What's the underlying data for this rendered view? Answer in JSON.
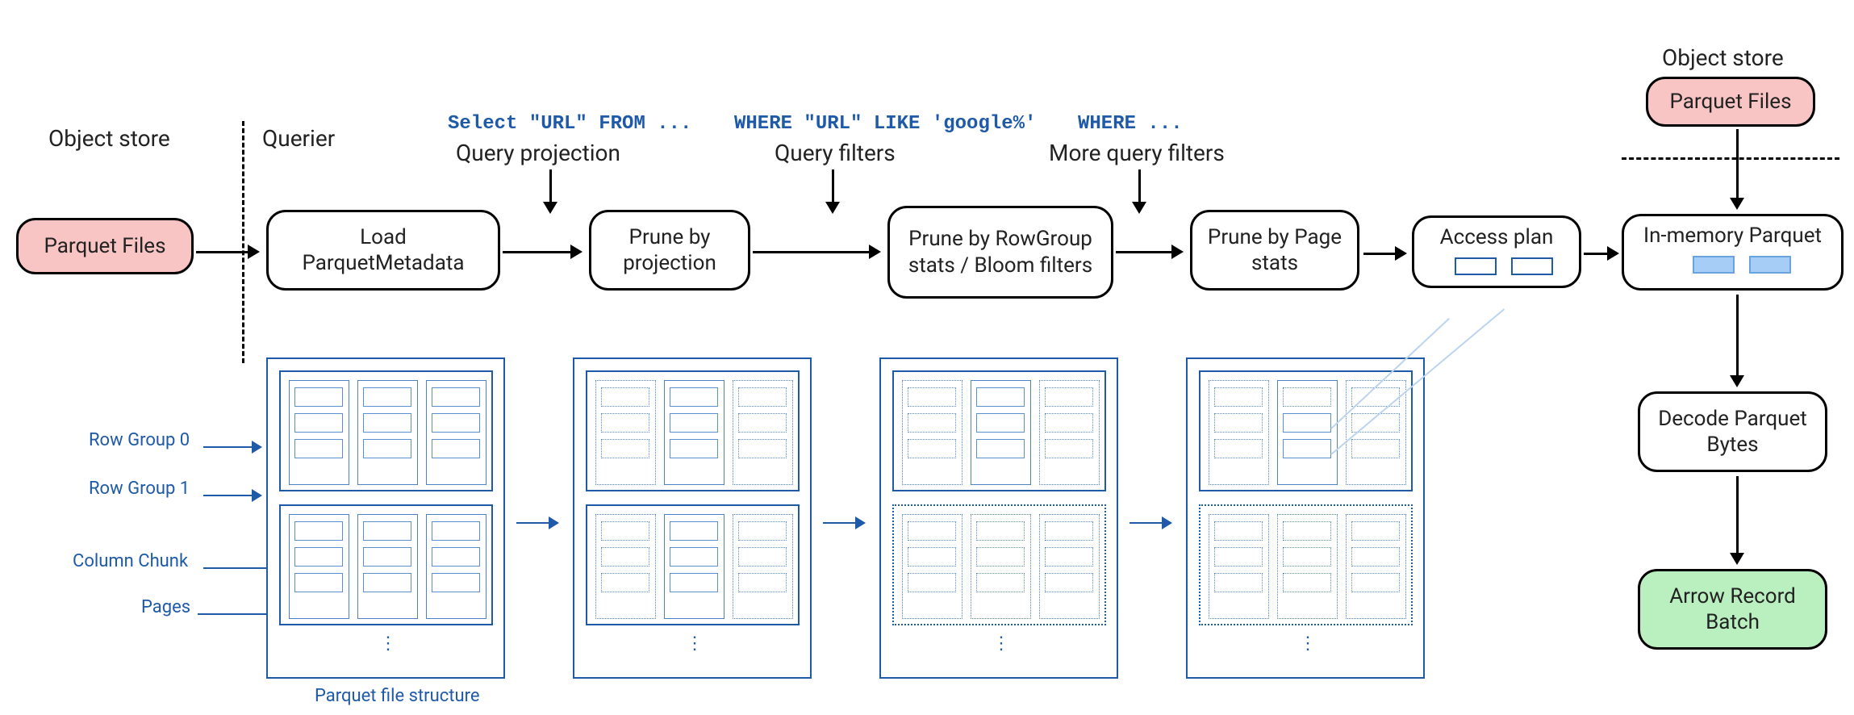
{
  "header": {
    "objectStoreLeft": "Object store",
    "querier": "Querier",
    "objectStoreRight": "Object store"
  },
  "annotations": {
    "projectionCode": "Select \"URL\" FROM ...",
    "projectionLabel": "Query projection",
    "filtersCode": "WHERE \"URL\" LIKE 'google%'",
    "filtersLabel": "Query filters",
    "moreFiltersCode": "WHERE ...",
    "moreFiltersLabel": "More query filters"
  },
  "pipeline": {
    "parquetFilesLeft": "Parquet Files",
    "loadMeta": "Load ParquetMetadata",
    "pruneProjection": "Prune by projection",
    "pruneRowgroup": "Prune by RowGroup stats / Bloom filters",
    "prunePage": "Prune by Page stats",
    "accessPlan": "Access plan",
    "parquetFilesRight": "Parquet Files",
    "inMemory": "In-memory Parquet",
    "decode": "Decode Parquet Bytes",
    "arrowBatch": "Arrow Record Batch"
  },
  "structureLabels": {
    "rowGroup0": "Row Group 0",
    "rowGroup1": "Row Group 1",
    "columnChunk": "Column Chunk",
    "pages": "Pages",
    "caption": "Parquet file structure"
  }
}
